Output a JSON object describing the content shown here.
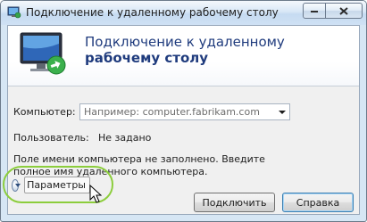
{
  "window": {
    "title": "Подключение к удаленному рабочему столу"
  },
  "banner": {
    "line1": "Подключение к удаленному",
    "line2": "рабочему столу"
  },
  "form": {
    "computer_label": "Компьютер:",
    "computer_placeholder": "Например: computer.fabrikam.com",
    "user_label": "Пользователь:",
    "user_value": "Не задано",
    "note": "Поле имени компьютера не заполнено. Введите полное имя удаленного компьютера."
  },
  "buttons": {
    "options": "Параметры",
    "connect": "Подключить",
    "help": "Справка"
  },
  "colors": {
    "banner_title": "#1f3b7d",
    "highlight_ring": "#8ccd3c"
  }
}
